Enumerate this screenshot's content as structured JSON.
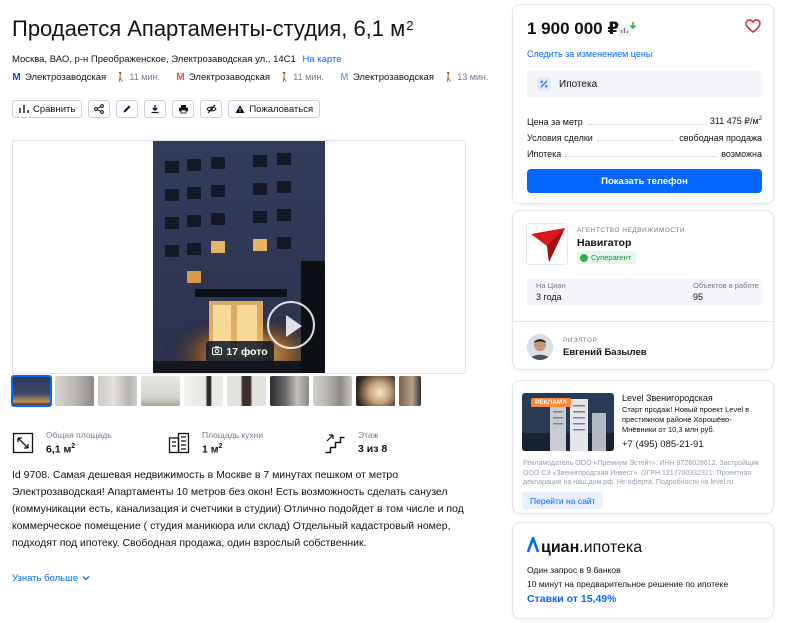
{
  "listing": {
    "title": "Продается Апартаменты-студия, 6,1 м",
    "title_unit_sup": "2",
    "address": "Москва, ВАО, р-н Преображенское, Электрозаводская ул., 14С1",
    "map_link": "На карте",
    "metro": [
      {
        "name": "Электрозаводская",
        "time": "11 мин.",
        "color": "#1a4fb3"
      },
      {
        "name": "Электрозаводская",
        "time": "11 мин.",
        "color": "#e0542d"
      },
      {
        "name": "Электрозаводская",
        "time": "13 мин.",
        "color": "#8fa8d6"
      }
    ]
  },
  "toolbar": {
    "compare_label": "Сравнить",
    "complain_label": "Пожаловаться"
  },
  "gallery": {
    "photo_count_label": "17 фото"
  },
  "features": [
    {
      "label": "Общая площадь",
      "value": "6,1 м",
      "sup": "2",
      "icon": "area-icon"
    },
    {
      "label": "Площадь кухни",
      "value": "1 м",
      "sup": "2",
      "icon": "kitchen-icon"
    },
    {
      "label": "Этаж",
      "value": "3 из 8",
      "sup": "",
      "icon": "stairs-icon"
    }
  ],
  "description": {
    "text": "Id 9708. Самая дешевая недвижимость в Москве в 7 минутах пешком от метро Электрозаводская! Апартаменты 10 метров без окон! Есть возможность сделать санузел (коммуникации есть, канализация и счетчики в студии) Отлично подойдет в том числе и под коммерческое помещение ( студия маникюра или склад) Отдельный кадастровый номер, подходят под ипотеку. Свободная продажа, один взрослый собственник.",
    "more_label": "Узнать больше"
  },
  "price_card": {
    "price": "1 900 000 ₽",
    "follow_label": "Следить за изменением цены",
    "mortgage_label": "Ипотека",
    "rows": [
      {
        "key": "Цена за метр",
        "value": "311 475 ₽/м",
        "sup": "2"
      },
      {
        "key": "Условия сделки",
        "value": "свободная продажа",
        "sup": ""
      },
      {
        "key": "Ипотека",
        "value": "возможна",
        "sup": ""
      }
    ],
    "call_label": "Показать телефон"
  },
  "agency": {
    "type_label": "АГЕНТСТВО НЕДВИЖИМОСТИ",
    "name": "Навигатор",
    "badge": "Суперагент",
    "on_cian_label": "На Циан",
    "on_cian_value": "3 года",
    "objects_label": "Объектов в работе",
    "objects_value": "95",
    "realtor_type": "РИЭЛТОР",
    "realtor_name": "Евгений Базылев"
  },
  "ad": {
    "tag": "РЕКЛАМА",
    "title": "Level Звенигородская",
    "text": "Старт продаж! Новый проект Level в престижном районе Хорошёво-Мнёвники от 10,3 млн руб.",
    "phone": "+7 (495) 085-21-91",
    "legal": "Рекламодатель ООО «Премиум Эстейт». ИНН 9726028612. Застройщик ООО СЗ «Звенигородская Инвест». ОГРН 1217700332321. Проектная декларация на наш.дом.рф. Не оферта. Подробности на level.ru",
    "button": "Перейти на сайт"
  },
  "cian_ipoteka": {
    "logo_part1": "циан",
    "logo_part2": ".ипотека",
    "line1": "Один запрос в 9 банков",
    "line2": "10 минут на предварительное решение по ипотеке",
    "rate": "Ставки от 15,49%"
  },
  "colors": {
    "accent": "#0468ff",
    "superagent": "#34ac4f",
    "ad_tag": "#ff8a3d"
  }
}
